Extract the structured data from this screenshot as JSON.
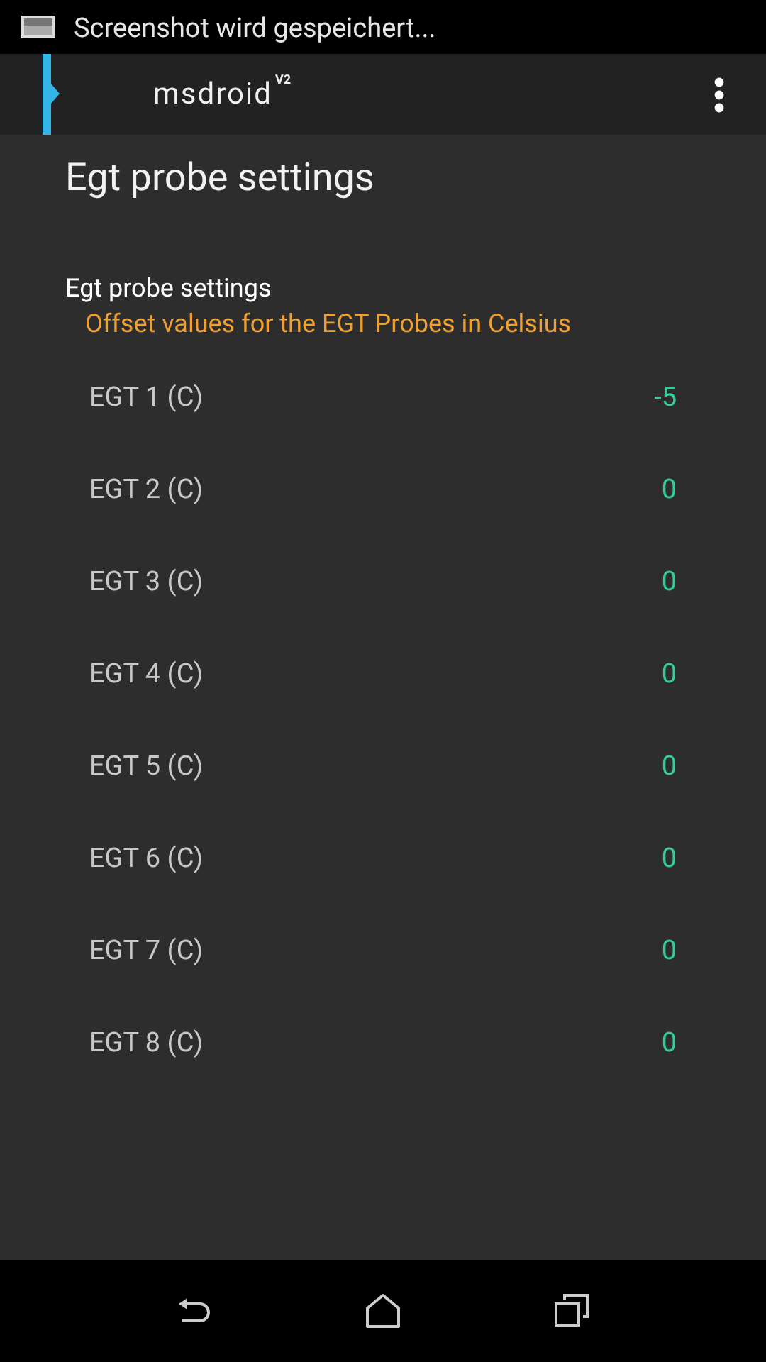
{
  "status_bar": {
    "notification": "Screenshot wird gespeichert..."
  },
  "action_bar": {
    "logo": "msdroid",
    "logo_version": "V2"
  },
  "page_title": "Egt probe settings",
  "category": {
    "title": "Egt probe settings",
    "summary": "Offset values for the EGT Probes in Celsius"
  },
  "settings": [
    {
      "label": "EGT 1 (C)",
      "value": "-5"
    },
    {
      "label": "EGT 2 (C)",
      "value": "0"
    },
    {
      "label": "EGT 3 (C)",
      "value": "0"
    },
    {
      "label": "EGT 4 (C)",
      "value": "0"
    },
    {
      "label": "EGT 5 (C)",
      "value": "0"
    },
    {
      "label": "EGT 6 (C)",
      "value": "0"
    },
    {
      "label": "EGT 7 (C)",
      "value": "0"
    },
    {
      "label": "EGT 8 (C)",
      "value": "0"
    }
  ]
}
